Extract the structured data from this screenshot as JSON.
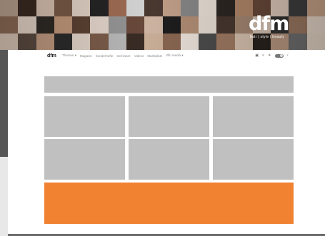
{
  "banner": {
    "tile_colors": [
      "#b9a08c",
      "#3a2a22",
      "#d9c1b0",
      "#7a5b48",
      "#e6d6c8",
      "#262626",
      "#a46f55",
      "#dcdcdc",
      "#4c3b33",
      "#c8a58e",
      "#8b8b8b",
      "#f0e6dc",
      "#2e2824",
      "#b48a6c",
      "#6a4a3a",
      "#e2cdbd",
      "#3f3f3f",
      "#caa58a",
      "#8b6a55",
      "#e3d2c4",
      "#2f2a26",
      "#c49a7c",
      "#5e4334",
      "#eadbd0",
      "#9a9a9a",
      "#6d4c3d",
      "#d6bda9",
      "#1f1f1f",
      "#b79279",
      "#efe4da",
      "#4a3a31",
      "#a88b75",
      "#dcc8b8",
      "#333333",
      "#9d7a63",
      "#e8d8ca",
      "#d6c3b3",
      "#5a4a40",
      "#c09a80",
      "#2c2c2c",
      "#e7d9cd",
      "#7f5f4c",
      "#bfbfbf",
      "#3c2e27",
      "#d2b59e",
      "#8e6a55",
      "#f2e9e1",
      "#4f4f4f",
      "#a37e66",
      "#ddc7b5",
      "#2a231f",
      "#bc9b83",
      "#707070",
      "#e5d4c5"
    ]
  },
  "logo": {
    "text": "dfm",
    "tagline": "hair | style | beauty"
  },
  "nav": {
    "logo": "dfm",
    "items": [
      {
        "label": "Themen ▾"
      },
      {
        "label": "Magazin"
      },
      {
        "label": "Sonderhefte"
      },
      {
        "label": "Seminare"
      },
      {
        "label": "Videos"
      },
      {
        "label": "Marktplatz"
      },
      {
        "label": "dfm media ▾"
      }
    ]
  },
  "colors": {
    "placeholder": "#c0c0c0",
    "orange_banner": "#f08232",
    "page_bg": "#ffffff"
  }
}
